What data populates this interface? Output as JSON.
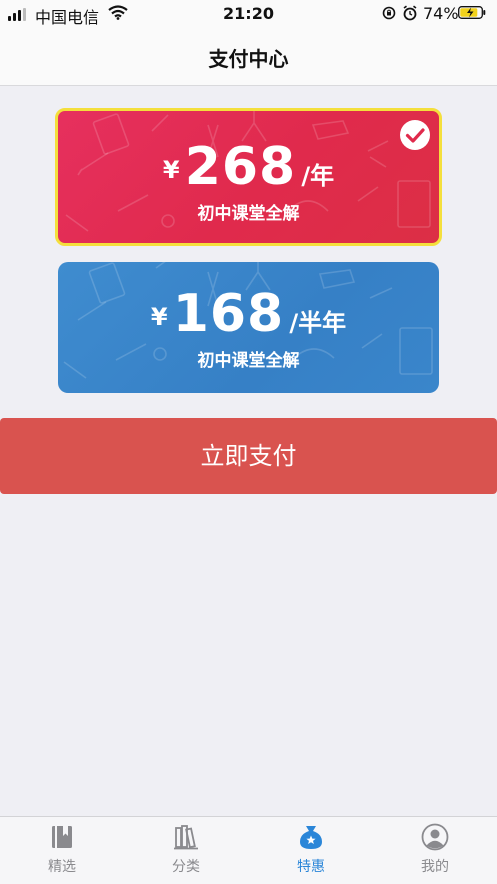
{
  "status_bar": {
    "carrier": "中国电信",
    "time": "21:20",
    "battery_percent": "74%"
  },
  "nav": {
    "title": "支付中心"
  },
  "plans": [
    {
      "currency": "¥",
      "amount": "268",
      "period": "/年",
      "description": "初中课堂全解",
      "selected": true,
      "color": "#e02a4c"
    },
    {
      "currency": "¥",
      "amount": "168",
      "period": "/半年",
      "description": "初中课堂全解",
      "selected": false,
      "color": "#3680c6"
    }
  ],
  "pay_button": {
    "label": "立即支付",
    "color": "#d9534f"
  },
  "tabbar": {
    "items": [
      {
        "label": "精选",
        "icon": "book-icon",
        "active": false
      },
      {
        "label": "分类",
        "icon": "bookshelf-icon",
        "active": false
      },
      {
        "label": "特惠",
        "icon": "discount-bag-icon",
        "active": true
      },
      {
        "label": "我的",
        "icon": "user-avatar-icon",
        "active": false
      }
    ],
    "active_color": "#2b86d8"
  }
}
